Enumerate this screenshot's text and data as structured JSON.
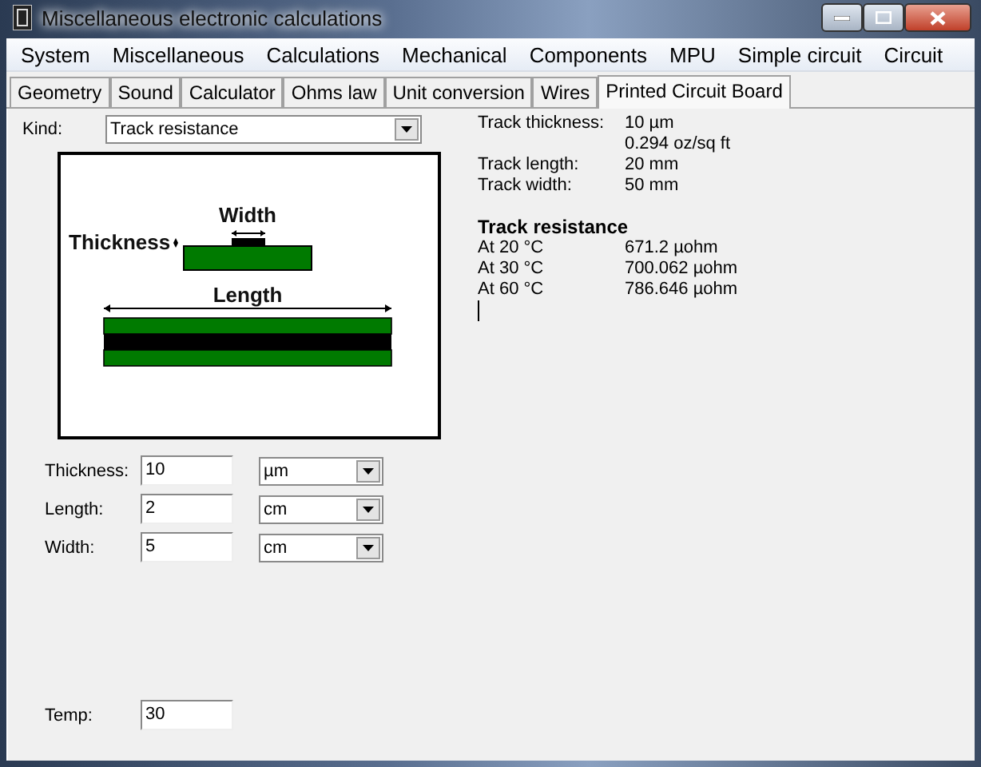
{
  "window": {
    "title": "Miscellaneous electronic calculations"
  },
  "menu": [
    "System",
    "Miscellaneous",
    "Calculations",
    "Mechanical",
    "Components",
    "MPU",
    "Simple circuit",
    "Circuit"
  ],
  "tabs": [
    {
      "label": "Geometry",
      "selected": false
    },
    {
      "label": "Sound",
      "selected": false
    },
    {
      "label": "Calculator",
      "selected": false
    },
    {
      "label": "Ohms law",
      "selected": false
    },
    {
      "label": "Unit conversion",
      "selected": false
    },
    {
      "label": "Wires",
      "selected": false
    },
    {
      "label": "Printed Circuit Board",
      "selected": true
    }
  ],
  "kind": {
    "label": "Kind:",
    "value": "Track resistance"
  },
  "diagram": {
    "width_label": "Width",
    "thickness_label": "Thickness",
    "length_label": "Length"
  },
  "inputs": [
    {
      "label": "Thickness:",
      "value": "10",
      "unit": "µm"
    },
    {
      "label": "Length:",
      "value": "2",
      "unit": "cm"
    },
    {
      "label": "Width:",
      "value": "5",
      "unit": "cm"
    }
  ],
  "temp": {
    "label": "Temp:",
    "value": "30"
  },
  "info": [
    {
      "label": "Track thickness:",
      "values": [
        "10 µm",
        "0.294 oz/sq ft"
      ]
    },
    {
      "label": "Track length:",
      "values": [
        "20 mm"
      ]
    },
    {
      "label": "Track width:",
      "values": [
        "50 mm"
      ]
    }
  ],
  "resistance": {
    "heading": "Track resistance",
    "rows": [
      {
        "label": "At 20 °C",
        "value": "671.2 µohm"
      },
      {
        "label": "At 30 °C",
        "value": "700.062 µohm"
      },
      {
        "label": "At 60 °C",
        "value": "786.646 µohm"
      }
    ]
  }
}
